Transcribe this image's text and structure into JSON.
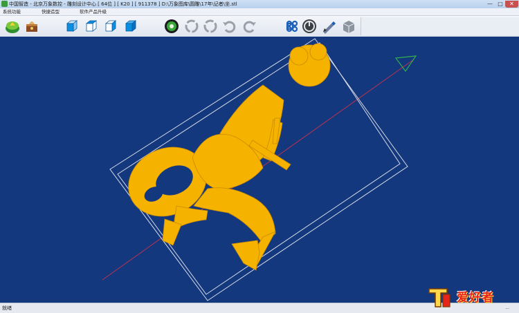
{
  "window": {
    "title": "中国智造 - 北京万象数控 - 雕刻设计中心 [ 64位 ] [ K20 ] [ 911378 ]    D:\\万象图库\\圆雕\\17年\\记者\\坐.stl",
    "min_glyph": "—",
    "max_glyph": "□",
    "close_glyph": "✕"
  },
  "menu": {
    "items": [
      {
        "label": "系统功能"
      },
      {
        "label": "快捷造型"
      },
      {
        "label": "软件产品升级"
      }
    ]
  },
  "toolbar": {
    "icons": [
      "open-file-icon",
      "save-treasure-icon",
      "cube-front-icon",
      "cube-top-icon",
      "cube-side-icon",
      "cube-iso-icon",
      "green-wheel-icon",
      "rotate-left-icon",
      "rotate-right-icon",
      "undo-arc-icon",
      "redo-arc-icon",
      "command-icon",
      "power-icon",
      "pen-tool-icon",
      "layer-box-icon"
    ]
  },
  "status": {
    "text": "就绪",
    "right": "..."
  },
  "watermark": {
    "text": "爱好者",
    "colors": {
      "red": "#e8231b",
      "gold": "#ffd84a"
    }
  },
  "colors": {
    "viewport_bg": "#14387e",
    "model": "#f5b300",
    "bbox": "#d8dce8"
  }
}
